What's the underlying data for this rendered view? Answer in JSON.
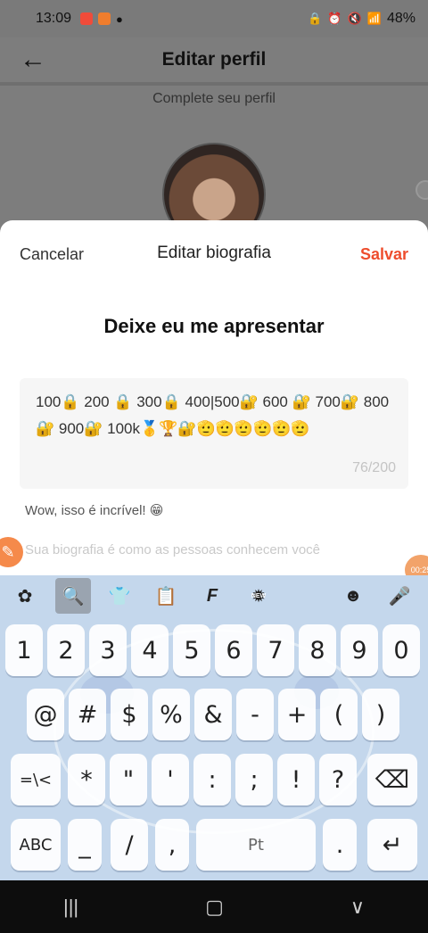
{
  "status_bar": {
    "time": "13:09",
    "battery": "48%"
  },
  "background_page": {
    "title": "Editar perfil",
    "subtitle": "Complete seu perfil"
  },
  "sheet": {
    "cancel_label": "Cancelar",
    "title": "Editar biografia",
    "save_label": "Salvar",
    "heading": "Deixe eu me apresentar",
    "bio_value": "100🔒 200 🔒 300🔒 400|500🔐 600 🔐 700🔐 800🔐 900🔐 100k🥇🏆🔐🫡🫡🫡🫡🫡🫡",
    "char_count": "76/200",
    "helper_text": "Wow, isso é incrível! 😁",
    "placeholder_hint": "Sua biografia é como as pessoas conhecem você"
  },
  "floating": {
    "timer": "00:25"
  },
  "keyboard": {
    "toolbar": [
      "apps-icon",
      "search-icon",
      "tshirt-icon",
      "clipboard-icon",
      "font-icon",
      "new-badge-icon",
      "emoji-icon",
      "mic-icon"
    ],
    "row_numbers": [
      "1",
      "2",
      "3",
      "4",
      "5",
      "6",
      "7",
      "8",
      "9",
      "0"
    ],
    "row_symbols1": [
      "@",
      "#",
      "$",
      "%",
      "&",
      "-",
      "+",
      "(",
      ")"
    ],
    "row_symbols2": [
      "=\\<",
      "*",
      "\"",
      "'",
      ":",
      ";",
      "!",
      "?"
    ],
    "row_bottom": {
      "abc": "ABC",
      "underscore": "_",
      "slash": "/",
      "comma": ",",
      "space": "Pt",
      "period": "."
    }
  },
  "colors": {
    "accent": "#ee4d2d",
    "keyboard_bg": "#c4d7ec"
  }
}
